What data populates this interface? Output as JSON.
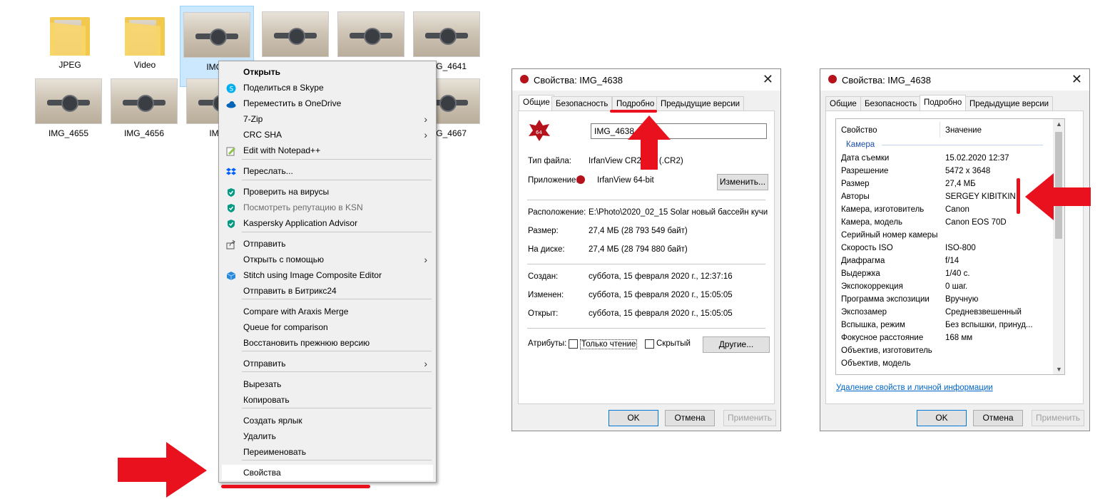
{
  "explorer": {
    "items": [
      {
        "caption": "JPEG",
        "type": "folder"
      },
      {
        "caption": "Video",
        "type": "folder"
      },
      {
        "caption": "IMG_",
        "type": "image"
      },
      {
        "caption": "",
        "type": "image"
      },
      {
        "caption": "",
        "type": "image"
      },
      {
        "caption": "IMG_4641",
        "type": "image"
      },
      {
        "caption": "IMG_4655",
        "type": "image"
      },
      {
        "caption": "IMG_4656",
        "type": "image"
      },
      {
        "caption": "IMG_",
        "type": "image"
      },
      {
        "caption": "IMG_4667",
        "type": "image"
      }
    ]
  },
  "context_menu": {
    "items": [
      {
        "label": "Открыть",
        "bold": true
      },
      {
        "label": "Поделиться в Skype",
        "icon": "skype-icon"
      },
      {
        "label": "Переместить в OneDrive",
        "icon": "onedrive-icon"
      },
      {
        "label": "7-Zip",
        "submenu": true
      },
      {
        "label": "CRC SHA",
        "submenu": true
      },
      {
        "label": "Edit with Notepad++",
        "icon": "notepad-icon"
      },
      {
        "label": "Переслать...",
        "icon": "dropbox-icon"
      },
      {
        "label": "Проверить на вирусы",
        "icon": "kaspersky-icon"
      },
      {
        "label": "Посмотреть репутацию в KSN",
        "icon": "kaspersky-icon",
        "disabled": true
      },
      {
        "label": "Kaspersky Application Advisor",
        "icon": "kaspersky-icon"
      },
      {
        "label": "Отправить",
        "icon": "share-icon"
      },
      {
        "label": "Открыть с помощью",
        "submenu": true
      },
      {
        "label": "Stitch using Image Composite Editor",
        "icon": "ice-icon"
      },
      {
        "label": "Отправить в Битрикс24"
      },
      {
        "label": "Compare with Araxis Merge"
      },
      {
        "label": "Queue for comparison"
      },
      {
        "label": "Восстановить прежнюю версию"
      },
      {
        "label": "Отправить",
        "submenu": true
      },
      {
        "label": "Вырезать"
      },
      {
        "label": "Копировать"
      },
      {
        "label": "Создать ярлык"
      },
      {
        "label": "Удалить"
      },
      {
        "label": "Переименовать"
      },
      {
        "label": "Свойства"
      }
    ]
  },
  "dialog1": {
    "title": "Свойства: IMG_4638",
    "tabs": [
      "Общие",
      "Безопасность",
      "Подробно",
      "Предыдущие версии"
    ],
    "filename": "IMG_4638",
    "file_type_label": "Тип файла:",
    "file_type_value": "IrfanView CR2 File (.CR2)",
    "app_label": "Приложение:",
    "app_value": "IrfanView 64-bit",
    "change_btn": "Изменить...",
    "location_label": "Расположение:",
    "location_value": "E:\\Photo\\2020_02_15 Solar новый бассейн кучи",
    "size_label": "Размер:",
    "size_value": "27,4 МБ (28 793 549 байт)",
    "disk_label": "На диске:",
    "disk_value": "27,4 МБ (28 794 880 байт)",
    "created_label": "Создан:",
    "created_value": "суббота, 15 февраля 2020 г., 12:37:16",
    "modified_label": "Изменен:",
    "modified_value": "суббота, 15 февраля 2020 г., 15:05:05",
    "opened_label": "Открыт:",
    "opened_value": "суббота, 15 февраля 2020 г., 15:05:05",
    "attr_label": "Атрибуты:",
    "readonly_label": "Только чтение",
    "hidden_label": "Скрытый",
    "other_btn": "Другие...",
    "ok": "OK",
    "cancel": "Отмена",
    "apply": "Применить"
  },
  "dialog2": {
    "title": "Свойства: IMG_4638",
    "tabs": [
      "Общие",
      "Безопасность",
      "Подробно",
      "Предыдущие версии"
    ],
    "col_property": "Свойство",
    "col_value": "Значение",
    "group": "Камера",
    "rows": [
      {
        "k": "Дата съемки",
        "v": "15.02.2020 12:37"
      },
      {
        "k": "Разрешение",
        "v": "5472 x 3648"
      },
      {
        "k": "Размер",
        "v": "27,4 МБ"
      },
      {
        "k": "Авторы",
        "v": "SERGEY KIBITKIN"
      },
      {
        "k": "Камера, изготовитель",
        "v": "Canon"
      },
      {
        "k": "Камера, модель",
        "v": "Canon EOS 70D"
      },
      {
        "k": "Серийный номер камеры",
        "v": ""
      },
      {
        "k": "Скорость ISO",
        "v": "ISO-800"
      },
      {
        "k": "Диафрагма",
        "v": "f/14"
      },
      {
        "k": "Выдержка",
        "v": "1/40 с."
      },
      {
        "k": "Экспокоррекция",
        "v": "0 шаг."
      },
      {
        "k": "Программа экспозиции",
        "v": "Вручную"
      },
      {
        "k": "Экспозамер",
        "v": "Средневзвешенный"
      },
      {
        "k": "Вспышка, режим",
        "v": "Без вспышки, принуд..."
      },
      {
        "k": "Фокусное расстояние",
        "v": "168 мм"
      },
      {
        "k": "Объектив, изготовитель",
        "v": ""
      },
      {
        "k": "Объектив, модель",
        "v": ""
      }
    ],
    "remove_link": "Удаление свойств и личной информации",
    "ok": "OK",
    "cancel": "Отмена",
    "apply": "Применить"
  },
  "colors": {
    "accent_red": "#e8111d",
    "selection": "#cce8ff",
    "link": "#0066cc"
  }
}
